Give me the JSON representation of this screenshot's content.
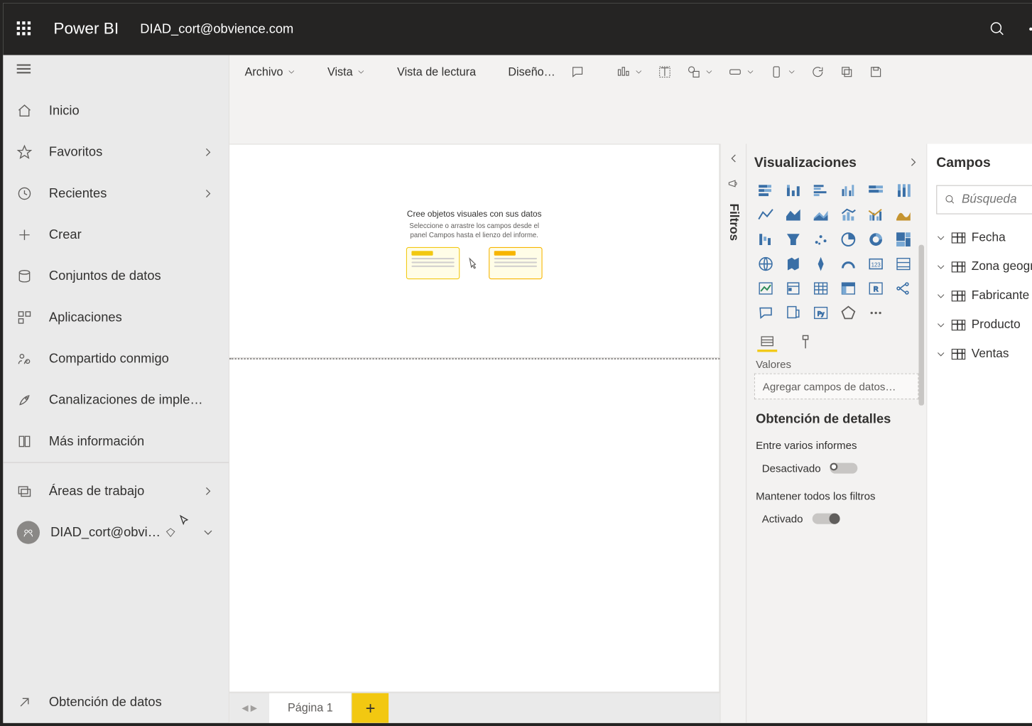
{
  "topbar": {
    "brand": "Power BI",
    "account": "DIAD_cort@obvience.com"
  },
  "sidebar": {
    "items": [
      {
        "label": "Inicio"
      },
      {
        "label": "Favoritos",
        "chevron": true
      },
      {
        "label": "Recientes",
        "chevron": true
      },
      {
        "label": "Crear"
      },
      {
        "label": "Conjuntos de datos"
      },
      {
        "label": "Aplicaciones"
      },
      {
        "label": "Compartido conmigo"
      },
      {
        "label": "Canalizaciones de imple…"
      },
      {
        "label": "Más información"
      }
    ],
    "workspaces": "Áreas de trabajo",
    "current_ws": "DIAD_cort@obvi…",
    "get_data": "Obtención de datos"
  },
  "toolbar": {
    "archivo": "Archivo",
    "vista": "Vista",
    "lectura": "Vista de lectura",
    "diseno": "Diseño…"
  },
  "canvas": {
    "title": "Cree objetos visuales con sus datos",
    "sub1": "Seleccione o arrastre los campos desde el",
    "sub2": "panel Campos hasta el lienzo del informe."
  },
  "filters": {
    "label": "Filtros"
  },
  "viz": {
    "header": "Visualizaciones",
    "values": "Valores",
    "add_fields": "Agregar campos de datos…",
    "drill_header": "Obtención de detalles",
    "cross": "Entre varios informes",
    "off": "Desactivado",
    "keep": "Mantener todos los filtros",
    "on": "Activado"
  },
  "fields": {
    "header": "Campos",
    "search": "Búsqueda",
    "tables": [
      "Fecha",
      "Zona geográfica",
      "Fabricante",
      "Producto",
      "Ventas"
    ]
  },
  "pages": {
    "page1": "Página 1"
  }
}
